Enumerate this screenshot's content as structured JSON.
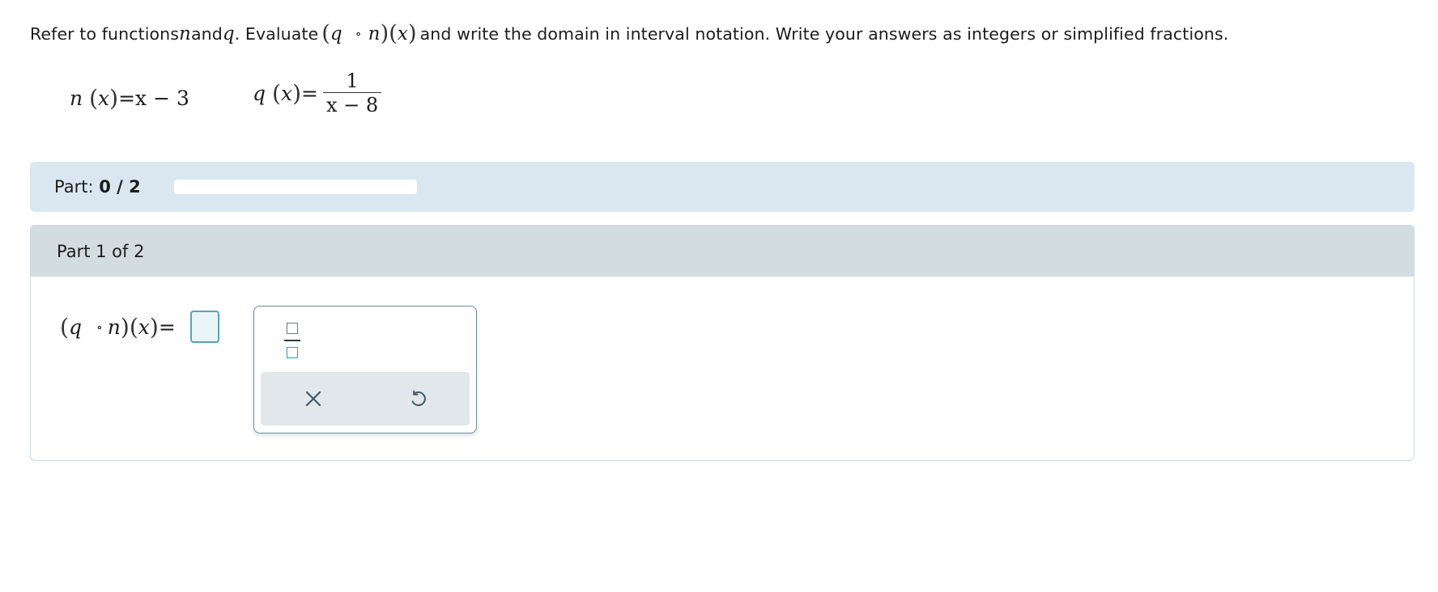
{
  "instructions": {
    "pre": "Refer to functions ",
    "var_n": "n",
    "and": " and ",
    "var_q": "q",
    "evaluate": ". Evaluate ",
    "comp_open": "(",
    "comp_q": "q",
    "comp_circ": "∘",
    "comp_n": "n",
    "comp_close": ")",
    "comp_x_open": "(",
    "comp_x": "x",
    "comp_x_close": ")",
    "post": " and write the domain in interval notation. Write your answers as integers or simplified fractions."
  },
  "functions": {
    "n": {
      "name": "n",
      "open": "(",
      "arg": "x",
      "close": ")",
      "equals": "=",
      "expr": "x − 3"
    },
    "q": {
      "name": "q",
      "open": "(",
      "arg": "x",
      "close": ")",
      "equals": "=",
      "numerator": "1",
      "denominator": "x − 8"
    }
  },
  "progress": {
    "label": "Part: ",
    "value": "0 / 2",
    "fraction": 0
  },
  "part": {
    "header": "Part 1 of 2",
    "answer_lhs": {
      "open": "(",
      "q": "q",
      "circ": "∘",
      "n": "n",
      "close": ")",
      "x_open": "(",
      "x": "x",
      "x_close": ")",
      "equals": "="
    },
    "answer_value": ""
  },
  "palette": {
    "fraction_icon": "fraction-template-icon",
    "clear_icon": "close-icon",
    "undo_icon": "undo-icon",
    "accent_color": "#1ea3b8"
  }
}
